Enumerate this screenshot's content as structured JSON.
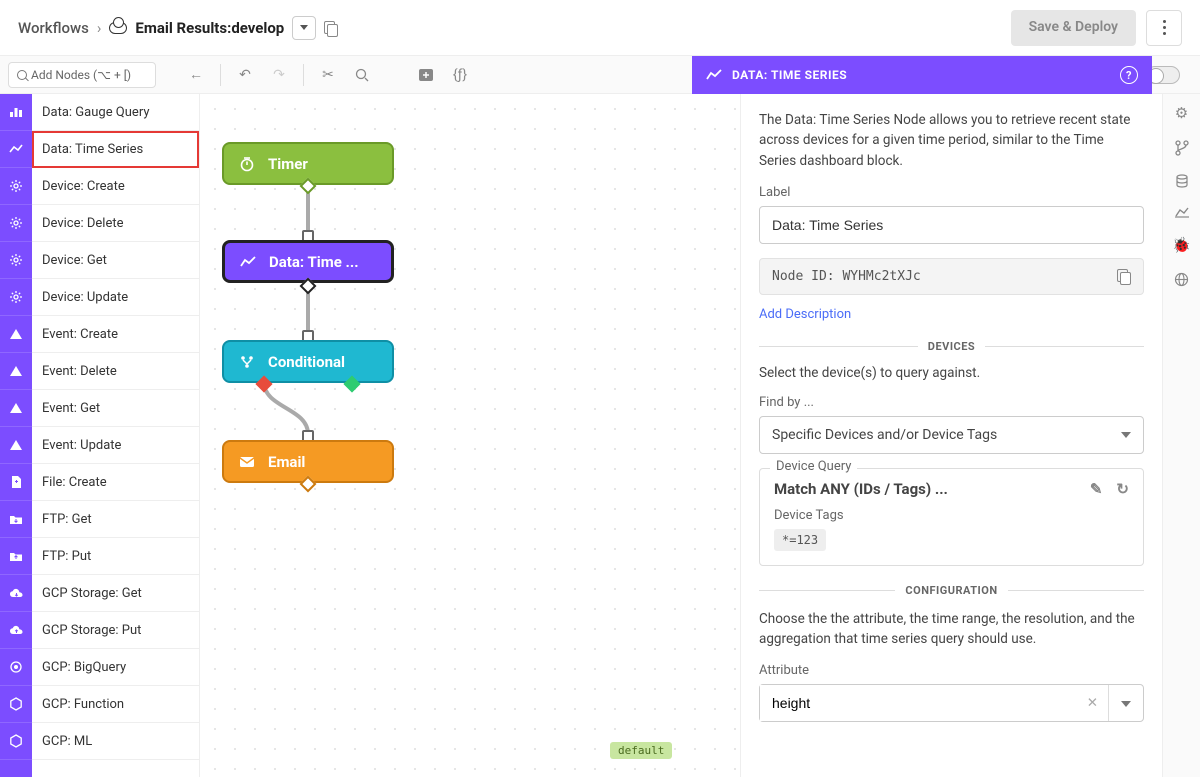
{
  "breadcrumb": {
    "root": "Workflows",
    "name": "Email Results:",
    "branch": "develop"
  },
  "topbar": {
    "save_label": "Save & Deploy"
  },
  "search": {
    "placeholder": "Add Nodes (⌥ + [)"
  },
  "node_list": [
    {
      "label": "Data: Gauge Query",
      "icon": "bar"
    },
    {
      "label": "Data: Time Series",
      "icon": "line",
      "highlight": true
    },
    {
      "label": "Device: Create",
      "icon": "gear"
    },
    {
      "label": "Device: Delete",
      "icon": "gear"
    },
    {
      "label": "Device: Get",
      "icon": "gear"
    },
    {
      "label": "Device: Update",
      "icon": "gear"
    },
    {
      "label": "Event: Create",
      "icon": "warn"
    },
    {
      "label": "Event: Delete",
      "icon": "warn"
    },
    {
      "label": "Event: Get",
      "icon": "warn"
    },
    {
      "label": "Event: Update",
      "icon": "warn"
    },
    {
      "label": "File: Create",
      "icon": "file"
    },
    {
      "label": "FTP: Get",
      "icon": "folder-down"
    },
    {
      "label": "FTP: Put",
      "icon": "folder-up"
    },
    {
      "label": "GCP Storage: Get",
      "icon": "cloud-down"
    },
    {
      "label": "GCP Storage: Put",
      "icon": "cloud-up"
    },
    {
      "label": "GCP: BigQuery",
      "icon": "eye"
    },
    {
      "label": "GCP: Function",
      "icon": "hex"
    },
    {
      "label": "GCP: ML",
      "icon": "hex"
    }
  ],
  "canvas": {
    "nodes": {
      "timer": "Timer",
      "data": "Data: Time ...",
      "cond": "Conditional",
      "email": "Email"
    },
    "default_badge": "default"
  },
  "panel": {
    "title": "DATA: TIME SERIES",
    "description": "The Data: Time Series Node allows you to retrieve recent state across devices for a given time period, similar to the Time Series dashboard block.",
    "label_field": "Label",
    "label_value": "Data: Time Series",
    "node_id_label": "Node ID:",
    "node_id": "WYHMc2tXJc",
    "add_description": "Add Description",
    "devices_header": "DEVICES",
    "devices_text": "Select the device(s) to query against.",
    "find_by_label": "Find by ...",
    "find_by_value": "Specific Devices and/or Device Tags",
    "device_query_label": "Device Query",
    "device_query_value": "Match ANY (IDs / Tags) ...",
    "device_tags_label": "Device Tags",
    "tag_chip": "*=123",
    "config_header": "CONFIGURATION",
    "config_text": "Choose the the attribute, the time range, the resolution, and the aggregation that time series query should use.",
    "attribute_label": "Attribute",
    "attribute_value": "height"
  }
}
